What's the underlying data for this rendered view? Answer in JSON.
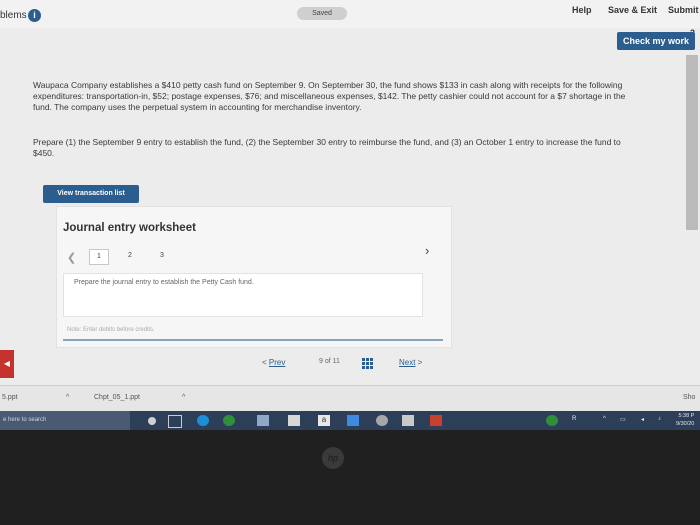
{
  "header": {
    "problems_label": "blems",
    "saved_label": "Saved",
    "help_label": "Help",
    "save_exit_label": "Save & Exit",
    "submit_label": "Submit",
    "check_my_work_label": "Check my work",
    "badge": "2"
  },
  "problem": {
    "text": "Waupaca Company establishes a $410 petty cash fund on September 9. On September 30, the fund shows $133 in cash along with receipts for the following expenditures: transportation-in, $52; postage expenses, $76; and miscellaneous expenses, $142. The petty cashier could not account for a $7 shortage in the fund. The company uses the perpetual system in accounting for merchandise inventory.",
    "prepare": "Prepare (1) the September 9 entry to establish the fund, (2) the September 30 entry to reimburse the fund, and (3) an October 1 entry to increase the fund to $450."
  },
  "view_transaction_label": "View transaction list",
  "worksheet": {
    "title": "Journal entry worksheet",
    "tabs": [
      "1",
      "2",
      "3"
    ],
    "instruction": "Prepare the journal entry to establish the Petty Cash fund.",
    "note": "Note: Enter debits before credits."
  },
  "pager": {
    "prev_label": "Prev",
    "count_label": "9 of 11",
    "next_label": "Next"
  },
  "downloads": {
    "item1": "5.ppt",
    "item2": "Chpt_05_1.ppt",
    "show_all": "Sho"
  },
  "taskbar": {
    "search_placeholder": "e here to search",
    "time": "5:38 P",
    "date": "9/30/20"
  },
  "colors": {
    "accent": "#2c5d8f",
    "taskbar": "#2d3e58"
  }
}
